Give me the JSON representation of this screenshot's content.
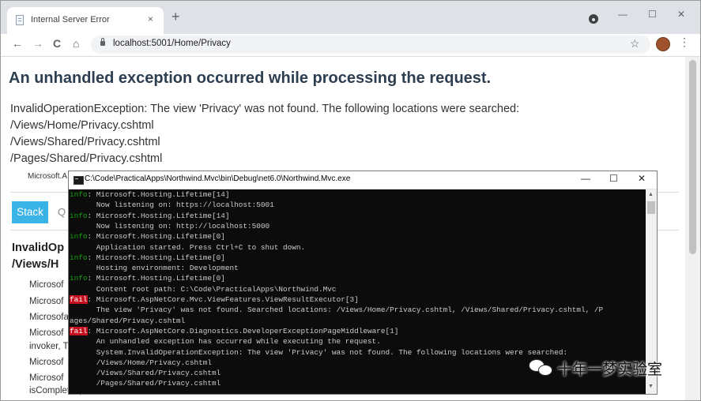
{
  "browser": {
    "tab_title": "Internal Server Error",
    "tab_close": "×",
    "new_tab": "+",
    "url": "localhost:5001/Home/Privacy",
    "controls": {
      "minimize": "—",
      "maximize": "☐",
      "close": "✕"
    },
    "nav": {
      "back": "←",
      "forward": "→",
      "reload": "C",
      "home": "⌂",
      "star": "☆",
      "menu": "⋮"
    }
  },
  "page": {
    "heading": "An unhandled exception occurred while processing the request.",
    "message_lines": [
      "InvalidOperationException: The view 'Privacy' was not found. The following locations were searched:",
      "/Views/Home/Privacy.cshtml",
      "/Views/Shared/Privacy.cshtml",
      "/Pages/Shared/Privacy.cshtml"
    ],
    "source_line": "Microsoft.A",
    "tabs": {
      "stack": "Stack",
      "query": "Q"
    },
    "exception_title_lines": [
      "InvalidOp",
      "/Views/H"
    ],
    "stack_frames": [
      "Microsof",
      "Microsof",
      "Microsofages/Shared/Privacy.cshtml",
      "Microsof",
      "invoker, T",
      "Microsof",
      "Microsof",
      "isCompleted)"
    ]
  },
  "console": {
    "title": "C:\\Code\\PracticalApps\\Northwind.Mvc\\bin\\Debug\\net6.0\\Northwind.Mvc.exe",
    "controls": {
      "minimize": "—",
      "maximize": "☐",
      "close": "✕"
    },
    "lines": [
      {
        "level": "info",
        "text": ": Microsoft.Hosting.Lifetime[14]"
      },
      {
        "level": "",
        "text": "      Now listening on: https://localhost:5001"
      },
      {
        "level": "info",
        "text": ": Microsoft.Hosting.Lifetime[14]"
      },
      {
        "level": "",
        "text": "      Now listening on: http://localhost:5000"
      },
      {
        "level": "info",
        "text": ": Microsoft.Hosting.Lifetime[0]"
      },
      {
        "level": "",
        "text": "      Application started. Press Ctrl+C to shut down."
      },
      {
        "level": "info",
        "text": ": Microsoft.Hosting.Lifetime[0]"
      },
      {
        "level": "",
        "text": "      Hosting environment: Development"
      },
      {
        "level": "info",
        "text": ": Microsoft.Hosting.Lifetime[0]"
      },
      {
        "level": "",
        "text": "      Content root path: C:\\Code\\PracticalApps\\Northwind.Mvc"
      },
      {
        "level": "fail",
        "text": ": Microsoft.AspNetCore.Mvc.ViewFeatures.ViewResultExecutor[3]"
      },
      {
        "level": "",
        "text": "      The view 'Privacy' was not found. Searched locations: /Views/Home/Privacy.cshtml, /Views/Shared/Privacy.cshtml, /P"
      },
      {
        "level": "",
        "text": "ages/Shared/Privacy.cshtml"
      },
      {
        "level": "fail",
        "text": ": Microsoft.AspNetCore.Diagnostics.DeveloperExceptionPageMiddleware[1]"
      },
      {
        "level": "",
        "text": "      An unhandled exception has occurred while executing the request."
      },
      {
        "level": "",
        "text": "      System.InvalidOperationException: The view 'Privacy' was not found. The following locations were searched:"
      },
      {
        "level": "",
        "text": "      /Views/Home/Privacy.cshtml"
      },
      {
        "level": "",
        "text": "      /Views/Shared/Privacy.cshtml"
      },
      {
        "level": "",
        "text": "      /Pages/Shared/Privacy.cshtml"
      }
    ]
  },
  "watermark": {
    "text": "十年一梦实验室"
  },
  "colors": {
    "info": "#13a10e",
    "fail": "#c50f1f",
    "accent": "#3ab3e6"
  }
}
